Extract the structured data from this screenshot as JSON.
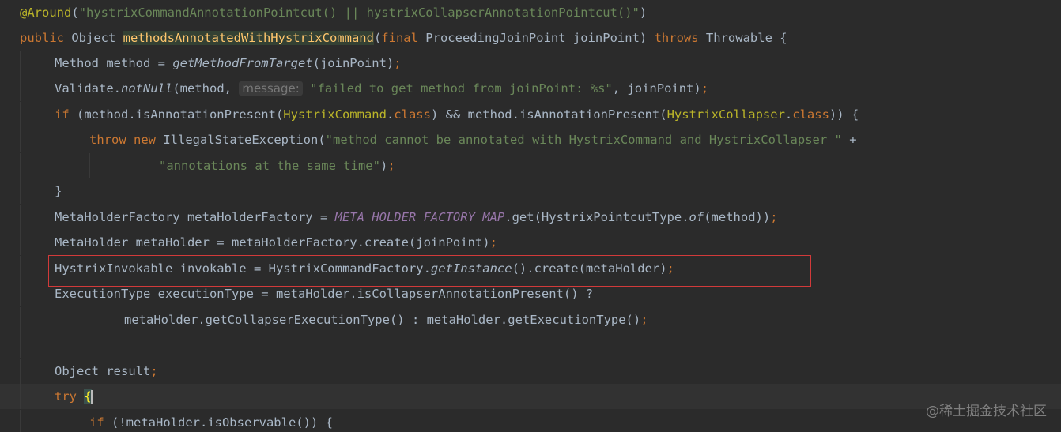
{
  "editor": {
    "annotation_line": {
      "annotation": "@Around",
      "open_paren": "(",
      "pointcut_string": "\"hystrixCommandAnnotationPointcut() || hystrixCollapserAnnotationPointcut()\"",
      "close_paren": ")"
    },
    "method_signature": {
      "modifier": "public",
      "return_type": " Object ",
      "method_name": "methodsAnnotatedWithHystrixCommand",
      "params_open": "(",
      "param_modifier": "final",
      "params_rest": " ProceedingJoinPoint joinPoint) ",
      "throws_kw": "throws",
      "throws_rest": " Throwable {"
    },
    "line3": {
      "prefix": "Method method = ",
      "call": "getMethodFromTarget",
      "args": "(joinPoint)",
      "semi": ";"
    },
    "line4": {
      "receiver": "Validate.",
      "call": "notNull",
      "args_open": "(method,",
      "param_hint": "message:",
      "message_string": "\"failed to get method from joinPoint: %s\"",
      "args_rest": ", joinPoint)",
      "semi": ";"
    },
    "line5": {
      "if_kw": "if",
      "part1": " (method.isAnnotationPresent(",
      "class1": "HystrixCommand",
      "dot1": ".",
      "class_kw1": "class",
      "part2": ") && method.isAnnotationPresent(",
      "class2": "HystrixCollapser",
      "dot2": ".",
      "class_kw2": "class",
      "part3": ")) {"
    },
    "line6": {
      "throw_kw": "throw",
      "new_kw": "new",
      "exception": " IllegalStateException(",
      "message_string": "\"method cannot be annotated with HystrixCommand and HystrixCollapser \"",
      "concat": " +"
    },
    "line7": {
      "message_string": "\"annotations at the same time\"",
      "close": ")",
      "semi": ";"
    },
    "line8": {
      "close_brace": "}"
    },
    "line9": {
      "prefix": "MetaHolderFactory metaHolderFactory = ",
      "constant": "META_HOLDER_FACTORY_MAP",
      "middle": ".get(HystrixPointcutType.",
      "call": "of",
      "args": "(method))",
      "semi": ";"
    },
    "line10": {
      "text": "MetaHolder metaHolder = metaHolderFactory.create(joinPoint)",
      "semi": ";"
    },
    "line11": {
      "prefix": "HystrixInvokable invokable = HystrixCommandFactory.",
      "call": "getInstance",
      "rest": "().create(metaHolder)",
      "semi": ";"
    },
    "line12": {
      "text": "ExecutionType executionType = metaHolder.isCollapserAnnotationPresent() ?"
    },
    "line13": {
      "text": "metaHolder.getCollapserExecutionType() : metaHolder.getExecutionType()",
      "semi": ";"
    },
    "line15": {
      "text": "Object result",
      "semi": ";"
    },
    "line16": {
      "try_kw": "try",
      "brace": "{"
    },
    "line17": {
      "if_kw": "if",
      "text": " (!metaHolder.isObservable()) {"
    }
  },
  "watermark": "@稀土掘金技术社区",
  "colors": {
    "background": "#2b2b2b",
    "keyword": "#cc7832",
    "string": "#6a8759",
    "annotation": "#bbb529",
    "constant": "#9876aa",
    "method_decl": "#ffc66d",
    "default_text": "#a9b7c6",
    "highlight_box": "#d23a3a"
  }
}
